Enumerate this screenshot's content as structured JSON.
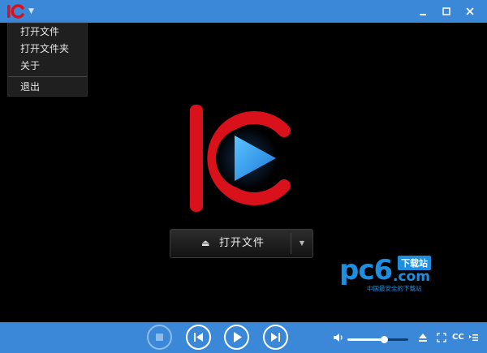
{
  "title_bar": {
    "app_menu": "app-menu",
    "buttons": [
      "minimize",
      "maximize",
      "close"
    ]
  },
  "menu": {
    "items": [
      "打开文件",
      "打开文件夹",
      "关于",
      "退出"
    ]
  },
  "open_button": {
    "label": "打开文件"
  },
  "watermark": {
    "brand": "pc6",
    "domain": ".com",
    "tag": "下载站",
    "slogan": "中国最安全的下载站"
  },
  "controls": {
    "volume_level": 0.6,
    "cc_label": "CC"
  },
  "colors": {
    "accent": "#3b87d8",
    "logo_red": "#d8111b",
    "play_blue": "#1e8fe0"
  }
}
